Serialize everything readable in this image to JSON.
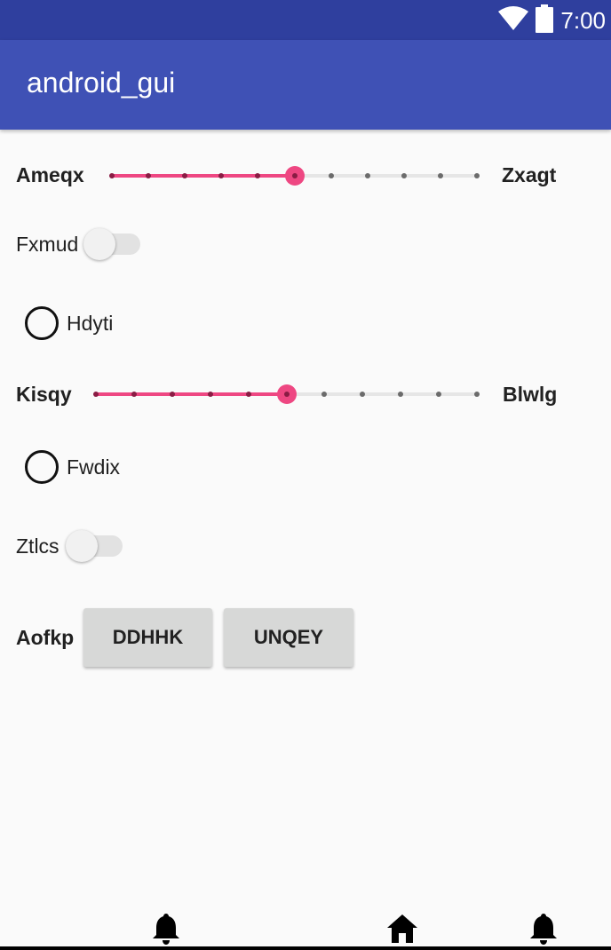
{
  "status_bar": {
    "time": "7:00",
    "icons": [
      "wifi-icon",
      "battery-icon"
    ]
  },
  "app_bar": {
    "title": "android_gui"
  },
  "form": {
    "slider1": {
      "left_label": "Ameqx",
      "right_label": "Zxagt",
      "steps": 10,
      "value": 5
    },
    "switch1": {
      "label": "Fxmud",
      "checked": false
    },
    "radio1": {
      "label": "Hdyti",
      "checked": false
    },
    "slider2": {
      "left_label": "Kisqy",
      "right_label": "Blwlg",
      "steps": 10,
      "value": 5
    },
    "radio2": {
      "label": "Fwdix",
      "checked": false
    },
    "switch2": {
      "label": "Ztlcs",
      "checked": false
    },
    "button_row": {
      "label": "Aofkp",
      "button1": "DDHHK",
      "button2": "UNQEY"
    }
  },
  "nav_bar": {
    "icons": [
      "bell-icon",
      "home-icon",
      "bell-icon"
    ]
  },
  "colors": {
    "primary": "#3f51b5",
    "primary_dark": "#2f3f9e",
    "accent": "#ee4782",
    "background": "#fafafa"
  }
}
